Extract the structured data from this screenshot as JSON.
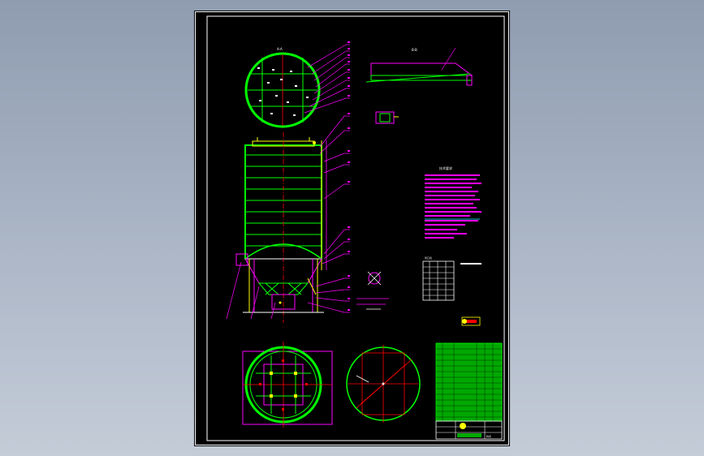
{
  "drawing": {
    "background": "#000000",
    "viewport_gradient": [
      "#8f9cb0",
      "#c4ccd8"
    ],
    "colors": {
      "frame": "#ffffff",
      "green": "#00ff00",
      "magenta": "#ff00ff",
      "red": "#ff0000",
      "yellow": "#ffff00",
      "cyan": "#00ffff",
      "white": "#ffffff"
    },
    "top_view_label": "A-A",
    "side_view_label": "B-B",
    "notes_title": "技术要求",
    "table_heading": "管口表",
    "title_block_name": "料仓"
  }
}
